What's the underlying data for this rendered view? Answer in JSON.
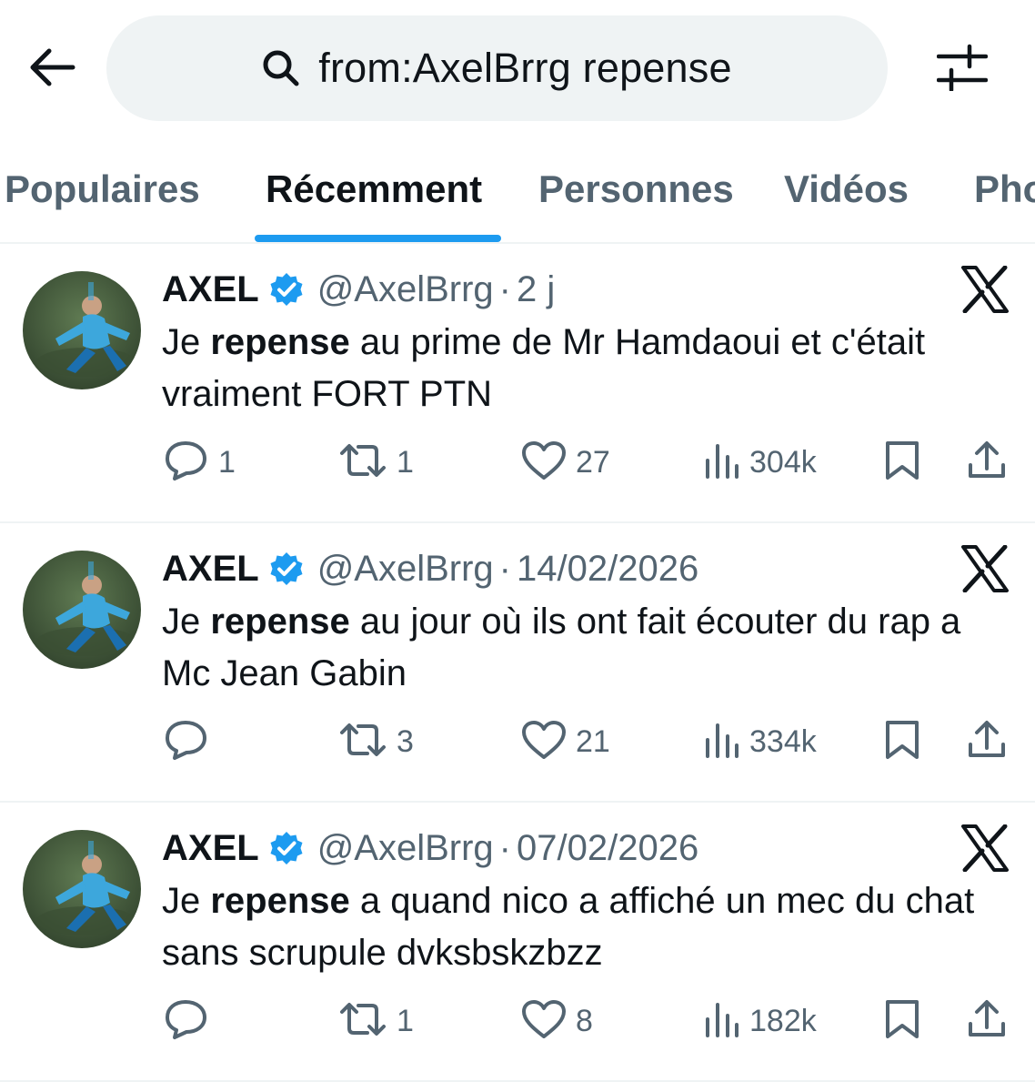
{
  "search": {
    "query": "from:AxelBrrg repense"
  },
  "tabs": [
    "Populaires",
    "Récemment",
    "Personnes",
    "Vidéos",
    "Photos"
  ],
  "active_tab": "Récemment",
  "colors": {
    "accent": "#1d9bf0",
    "secondary_text": "#536471",
    "primary_text": "#0f1419",
    "search_bg": "#eff3f4"
  },
  "icons": [
    "back-arrow-icon",
    "search-icon",
    "filter-sliders-icon",
    "verified-badge-icon",
    "x-logo-icon",
    "reply-icon",
    "retweet-icon",
    "like-icon",
    "views-icon",
    "bookmark-icon",
    "share-icon"
  ],
  "tweets": [
    {
      "name": "AXEL",
      "handle": "@AxelBrrg",
      "dot": "·",
      "time": "2 j",
      "text_before": "Je ",
      "text_bold": "repense",
      "text_after": " au prime de Mr Hamdaoui et c'était vraiment FORT PTN",
      "replies": "1",
      "retweets": "1",
      "likes": "27",
      "views": "304k"
    },
    {
      "name": "AXEL",
      "handle": "@AxelBrrg",
      "dot": "·",
      "time": "14/02/2026",
      "text_before": "Je ",
      "text_bold": "repense",
      "text_after": " au jour où ils ont fait écouter du rap a Mc Jean Gabin",
      "replies": "",
      "retweets": "3",
      "likes": "21",
      "views": "334k"
    },
    {
      "name": "AXEL",
      "handle": "@AxelBrrg",
      "dot": "·",
      "time": "07/02/2026",
      "text_before": "Je ",
      "text_bold": "repense",
      "text_after": " a quand nico a affiché un mec du chat sans scrupule dvksbskzbzz",
      "replies": "",
      "retweets": "1",
      "likes": "8",
      "views": "182k"
    }
  ]
}
